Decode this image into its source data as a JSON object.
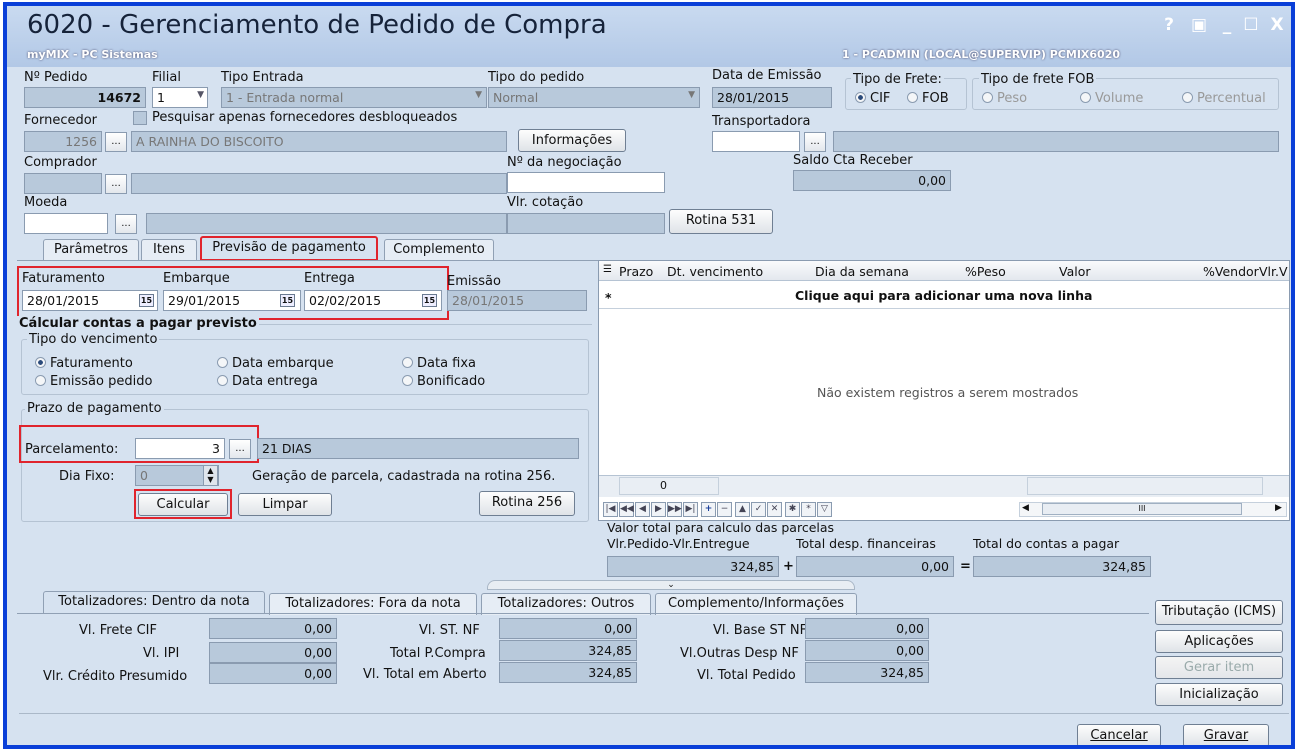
{
  "window": {
    "title": "6020 - Gerenciamento de Pedido de Compra",
    "app": "myMIX - PC Sistemas",
    "session": "1 - PCADMIN (LOCAL@SUPERVIP) PCMIX6020",
    "controls": [
      "?",
      "▣",
      "_",
      "☐",
      "X"
    ]
  },
  "header": {
    "pedido_label": "Nº Pedido",
    "pedido_value": "14672",
    "filial_label": "Filial",
    "filial_value": "1",
    "tipo_entrada_label": "Tipo Entrada",
    "tipo_entrada_value": "1 - Entrada normal",
    "tipo_pedido_label": "Tipo do pedido",
    "tipo_pedido_value": "Normal",
    "data_emissao_label": "Data de Emissão",
    "data_emissao_value": "28/01/2015",
    "tipo_frete_label": "Tipo de Frete:",
    "frete_cif": "CIF",
    "frete_fob": "FOB",
    "tipo_frete_fob_label": "Tipo de frete FOB",
    "fob_peso": "Peso",
    "fob_volume": "Volume",
    "fob_percentual": "Percentual",
    "fornecedor_label": "Fornecedor",
    "fornecedor_code": "1256",
    "fornecedor_name": "A RAINHA DO BISCOITO",
    "pesquisar_label": "Pesquisar apenas fornecedores desbloqueados",
    "informacoes_button": "Informações",
    "transportadora_label": "Transportadora",
    "comprador_label": "Comprador",
    "negociacao_label": "Nº da negociação",
    "saldo_label": "Saldo Cta Receber",
    "saldo_value": "0,00",
    "moeda_label": "Moeda",
    "cotacao_label": "Vlr. cotação",
    "rotina531_button": "Rotina 531",
    "ellipsis": "..."
  },
  "tabs": [
    "Parâmetros",
    "Itens",
    "Previsão de pagamento",
    "Complemento"
  ],
  "dates": {
    "faturamento_label": "Faturamento",
    "faturamento_value": "28/01/2015",
    "embarque_label": "Embarque",
    "embarque_value": "29/01/2015",
    "entrega_label": "Entrega",
    "entrega_value": "02/02/2015",
    "emissao_label": "Emissão",
    "emissao_value": "28/01/2015",
    "cal_icon": "15"
  },
  "calc": {
    "title": "Cálcular contas a pagar previsto",
    "tipo_venc_label": "Tipo do vencimento",
    "opt_faturamento": "Faturamento",
    "opt_data_embarque": "Data embarque",
    "opt_data_fixa": "Data fixa",
    "opt_emissao": "Emissão pedido",
    "opt_data_entrega": "Data entrega",
    "opt_bonificado": "Bonificado",
    "prazo_label": "Prazo de pagamento",
    "parcelamento_label": "Parcelamento:",
    "parcelamento_value": "3",
    "parcelamento_desc": "21 DIAS",
    "dia_fixo_label": "Dia Fixo:",
    "dia_fixo_value": "0",
    "geracao_text": "Geração de parcela, cadastrada na rotina 256.",
    "calcular_button": "Calcular",
    "limpar_button": "Limpar",
    "rotina256_button": "Rotina 256"
  },
  "grid": {
    "columns": [
      "Prazo",
      "Dt. vencimento",
      "Dia da semana",
      "%Peso",
      "Valor",
      "%Vendor",
      "Vlr.V"
    ],
    "add_row": "Clique aqui para adicionar uma nova linha",
    "empty": "Não existem registros a serem mostrados",
    "footer_count": "0",
    "nav": [
      "|◀",
      "◀◀",
      "◀",
      "▶",
      "▶▶",
      "▶|",
      "+",
      "−",
      "▲",
      "✓",
      "✕",
      "✱",
      "*",
      "▽"
    ],
    "scroll_label": "III"
  },
  "totals": {
    "title": "Valor total para calculo das parcelas",
    "pedido_label": "Vlr.Pedido-Vlr.Entregue",
    "pedido_value": "324,85",
    "desp_label": "Total desp. financeiras",
    "desp_value": "0,00",
    "contas_label": "Total do contas a pagar",
    "contas_value": "324,85",
    "plus": "+",
    "eq": "="
  },
  "bottom_tabs": [
    "Totalizadores: Dentro da nota",
    "Totalizadores: Fora da nota",
    "Totalizadores: Outros",
    "Complemento/Informações"
  ],
  "totalizadores": {
    "frete_cif_label": "Vl. Frete CIF",
    "frete_cif_value": "0,00",
    "ipi_label": "Vl. IPI",
    "ipi_value": "0,00",
    "credito_label": "Vlr. Crédito Presumido",
    "credito_value": "0,00",
    "st_nf_label": "Vl. ST. NF",
    "st_nf_value": "0,00",
    "total_compra_label": "Total P.Compra",
    "total_compra_value": "324,85",
    "total_aberto_label": "Vl. Total em Aberto",
    "total_aberto_value": "324,85",
    "base_st_label": "Vl. Base ST NF",
    "base_st_value": "0,00",
    "outras_label": "Vl.Outras Desp NF",
    "outras_value": "0,00",
    "total_pedido_label": "Vl. Total Pedido",
    "total_pedido_value": "324,85"
  },
  "side_buttons": {
    "tributacao": "Tributação (ICMS)",
    "aplicacoes": "Aplicações",
    "gerar_item": "Gerar item",
    "inicializacao": "Inicialização"
  },
  "footer": {
    "cancelar": "Cancelar",
    "gravar": "Gravar"
  }
}
